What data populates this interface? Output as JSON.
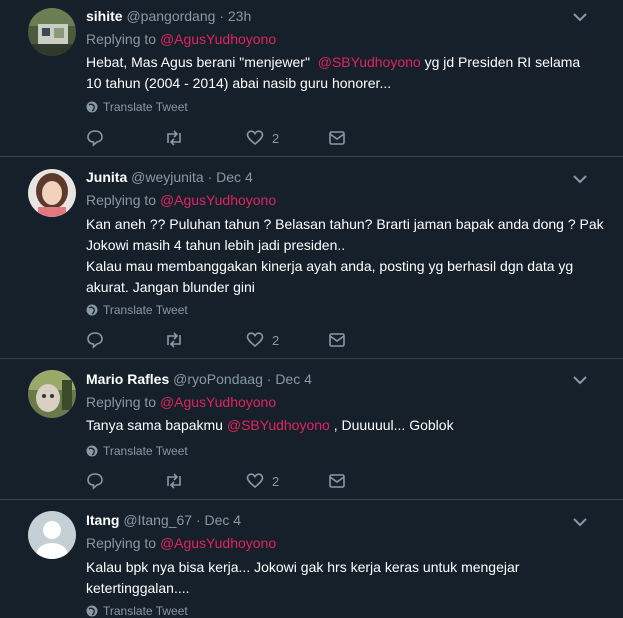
{
  "common": {
    "replying": "Replying to",
    "translate": "Translate Tweet",
    "dot": "·"
  },
  "tweets": [
    {
      "name": "sihite",
      "handle": "@pangordang",
      "time": "23h",
      "reply_to": "@AgusYudhoyono",
      "text_parts": [
        "Hebat, Mas Agus berani \"menjewer\"",
        "@SBYudhoyono",
        "yg jd Presiden RI selama",
        "10 tahun (2004 - 2014) abai nasib guru honorer..."
      ],
      "likes": "2"
    },
    {
      "name": "Junita",
      "handle": "@weyjunita",
      "time": "Dec 4",
      "reply_to": "@AgusYudhoyono",
      "lines": [
        "Kan aneh ?? Puluhan tahun ? Belasan tahun? Brarti jaman bapak anda dong ? Pak",
        "Jokowi masih 4 tahun lebih jadi presiden..",
        "Kalau mau membanggakan kinerja ayah anda, posting yg berhasil dgn data yg",
        "akurat. Jangan blunder gini"
      ],
      "likes": "2"
    },
    {
      "name": "Mario Rafles",
      "handle": "@ryoPondaag",
      "time": "Dec 4",
      "reply_to": "@AgusYudhoyono",
      "text_parts": [
        "Tanya sama bapakmu",
        "@SBYudhoyono",
        ", Duuuuul... Goblok"
      ],
      "likes": "2"
    },
    {
      "name": "Itang",
      "handle": "@Itang_67",
      "time": "Dec 4",
      "reply_to": "@AgusYudhoyono",
      "lines": [
        "Kalau bpk nya bisa kerja... Jokowi gak hrs kerja keras untuk mengejar",
        "ketertinggalan...."
      ]
    }
  ]
}
